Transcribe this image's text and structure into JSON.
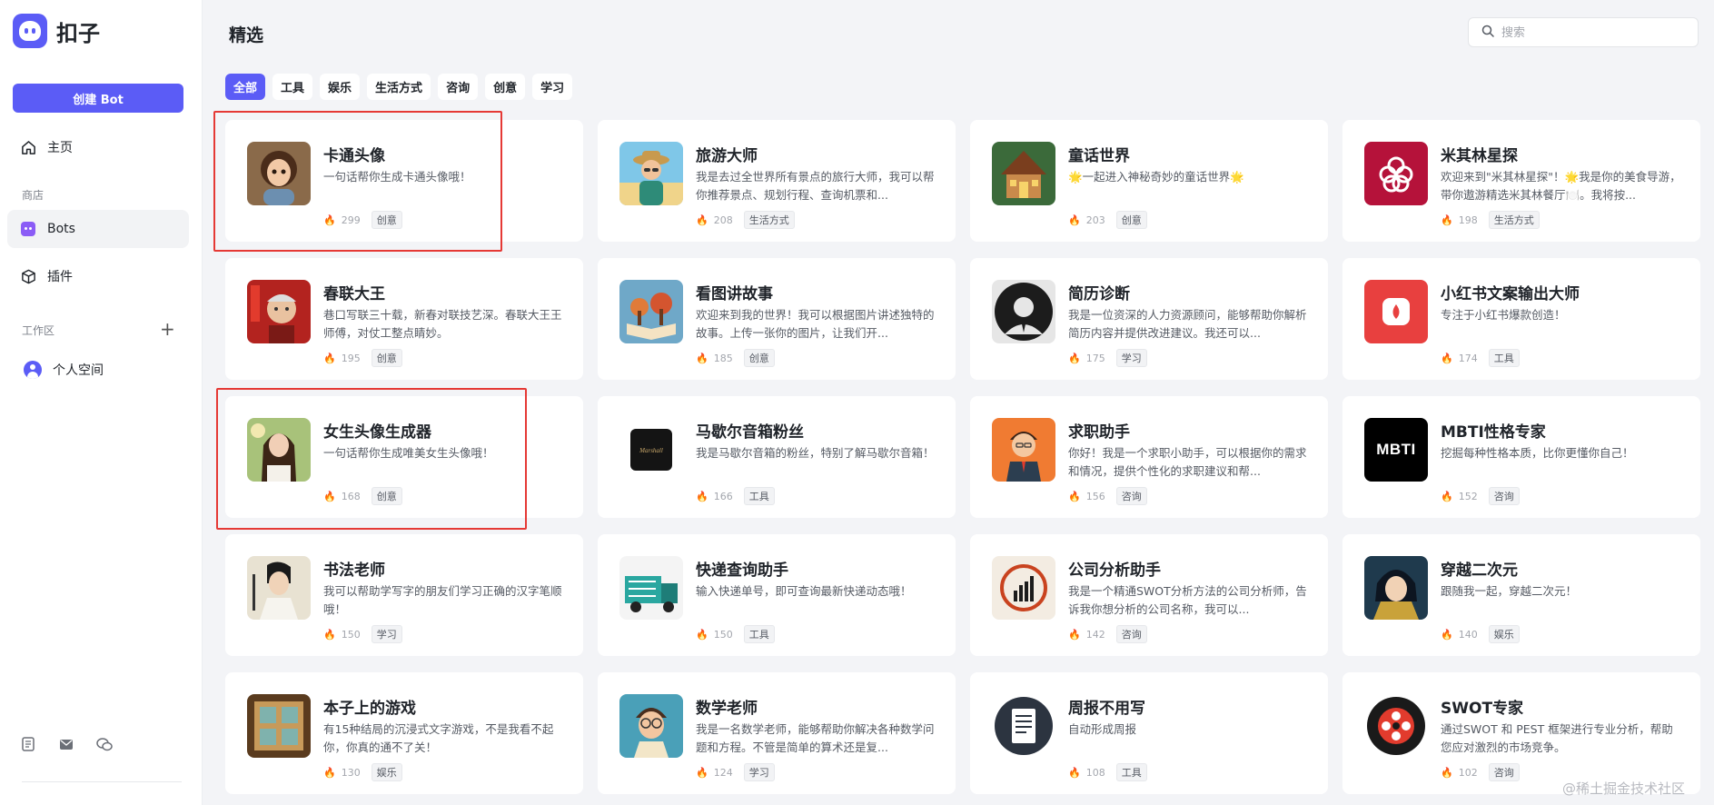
{
  "app": {
    "name": "扣子"
  },
  "sidebar": {
    "create_button": "创建 Bot",
    "home": "主页",
    "store_label": "商店",
    "bots": "Bots",
    "plugins": "插件",
    "workspace_label": "工作区",
    "personal_space": "个人空间"
  },
  "main": {
    "title": "精选",
    "search_placeholder": "搜索",
    "tabs": [
      "全部",
      "工具",
      "娱乐",
      "生活方式",
      "咨询",
      "创意",
      "学习"
    ]
  },
  "cards": [
    {
      "name": "卡通头像",
      "desc": "一句话帮你生成卡通头像哦！",
      "count": "299",
      "tag": "创意",
      "thumb": "cartoon-girl-thumb"
    },
    {
      "name": "旅游大师",
      "desc": "我是去过全世界所有景点的旅行大师，我可以帮你推荐景点、规划行程、查询机票和...",
      "count": "208",
      "tag": "生活方式",
      "thumb": "traveler-thumb"
    },
    {
      "name": "童话世界",
      "desc": "🌟一起进入神秘奇妙的童话世界🌟",
      "count": "203",
      "tag": "创意",
      "thumb": "fairy-house-thumb"
    },
    {
      "name": "米其林星探",
      "desc": "欢迎来到\"米其林星探\"！🌟我是你的美食导游，带你遨游精选米其林餐厅🍽️。我将按...",
      "count": "198",
      "tag": "生活方式",
      "thumb": "michelin-thumb"
    },
    {
      "name": "春联大王",
      "desc": "巷口写联三十载，新春对联技艺深。春联大王王师傅，对仗工整点睛妙。",
      "count": "195",
      "tag": "创意",
      "thumb": "old-man-thumb"
    },
    {
      "name": "看图讲故事",
      "desc": "欢迎来到我的世界！我可以根据图片讲述独特的故事。上传一张你的图片，让我们开...",
      "count": "185",
      "tag": "创意",
      "thumb": "storybook-thumb"
    },
    {
      "name": "简历诊断",
      "desc": "我是一位资深的人力资源顾问，能够帮助你解析简历内容并提供改进建议。我还可以...",
      "count": "175",
      "tag": "学习",
      "thumb": "hr-thumb"
    },
    {
      "name": "小红书文案输出大师",
      "desc": "专注于小红书爆款创造！",
      "count": "174",
      "tag": "工具",
      "thumb": "xhs-thumb"
    },
    {
      "name": "女生头像生成器",
      "desc": "一句话帮你生成唯美女生头像哦！",
      "count": "168",
      "tag": "创意",
      "thumb": "girl-photo-thumb"
    },
    {
      "name": "马歇尔音箱粉丝",
      "desc": "我是马歇尔音箱的粉丝，特别了解马歇尔音箱！",
      "count": "166",
      "tag": "工具",
      "thumb": "speaker-thumb"
    },
    {
      "name": "求职助手",
      "desc": "你好！我是一个求职小助手，可以根据你的需求和情况，提供个性化的求职建议和帮...",
      "count": "156",
      "tag": "咨询",
      "thumb": "job-man-thumb"
    },
    {
      "name": "MBTI性格专家",
      "desc": "挖掘每种性格本质，比你更懂你自己！",
      "count": "152",
      "tag": "咨询",
      "thumb": "mbti-thumb",
      "thumb_text": "MBTI"
    },
    {
      "name": "书法老师",
      "desc": "我可以帮助学写字的朋友们学习正确的汉字笔顺哦！",
      "count": "150",
      "tag": "学习",
      "thumb": "calligrapher-thumb"
    },
    {
      "name": "快递查询助手",
      "desc": "输入快递单号，即可查询最新快递动态哦！",
      "count": "150",
      "tag": "工具",
      "thumb": "truck-thumb"
    },
    {
      "name": "公司分析助手",
      "desc": "我是一个精通SWOT分析方法的公司分析师，告诉我你想分析的公司名称，我可以...",
      "count": "142",
      "tag": "咨询",
      "thumb": "chart-thumb"
    },
    {
      "name": "穿越二次元",
      "desc": "跟随我一起，穿越二次元！",
      "count": "140",
      "tag": "娱乐",
      "thumb": "anime-thumb"
    },
    {
      "name": "本子上的游戏",
      "desc": "有15种结局的沉浸式文字游戏，不是我看不起你，你真的通不了关！",
      "count": "130",
      "tag": "娱乐",
      "thumb": "board-game-thumb"
    },
    {
      "name": "数学老师",
      "desc": "我是一名数学老师，能够帮助你解决各种数学问题和方程。不管是简单的算术还是复...",
      "count": "124",
      "tag": "学习",
      "thumb": "math-teacher-thumb"
    },
    {
      "name": "周报不用写",
      "desc": "自动形成周报",
      "count": "108",
      "tag": "工具",
      "thumb": "report-thumb"
    },
    {
      "name": "SWOT专家",
      "desc": "通过SWOT 和 PEST 框架进行专业分析，帮助您应对激烈的市场竞争。",
      "count": "102",
      "tag": "咨询",
      "thumb": "swot-thumb"
    }
  ],
  "watermark": "@稀土掘金技术社区"
}
